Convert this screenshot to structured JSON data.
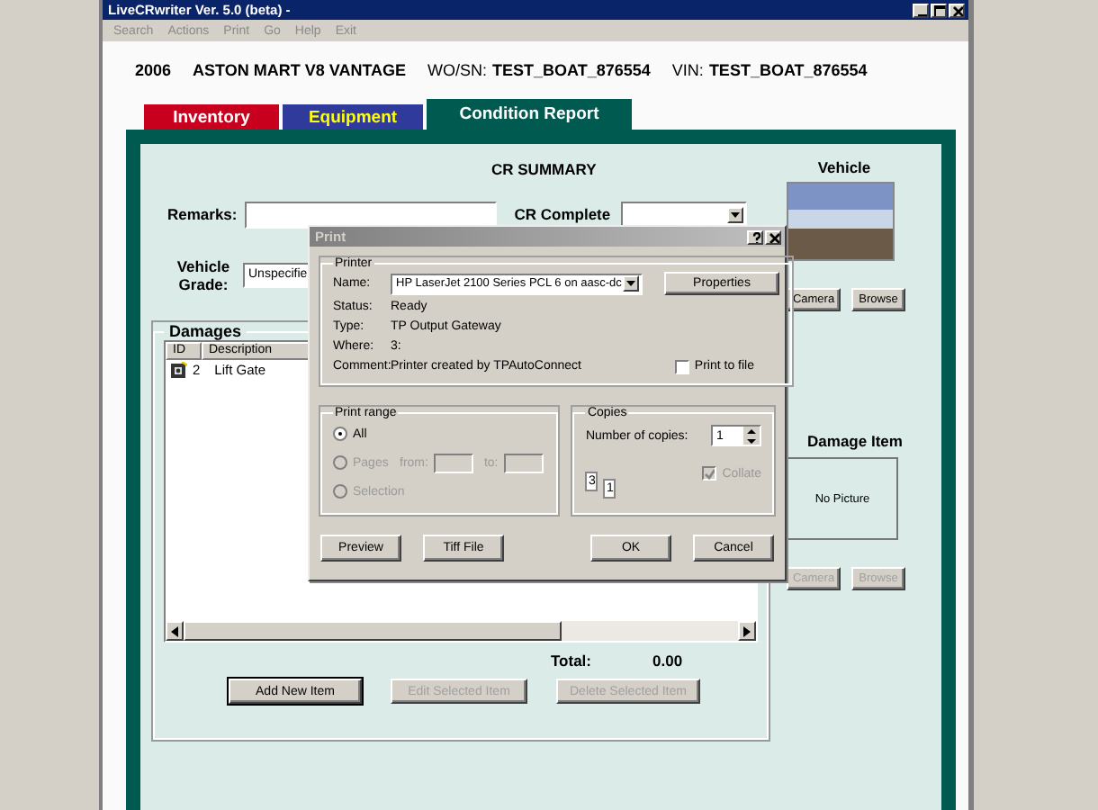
{
  "window": {
    "title": "LiveCRwriter Ver. 5.0 (beta) -"
  },
  "menu": [
    {
      "label": "Search",
      "disabled": true
    },
    {
      "label": "Actions",
      "disabled": true
    },
    {
      "label": "Print",
      "disabled": true
    },
    {
      "label": "Go",
      "disabled": true
    },
    {
      "label": "Help",
      "disabled": true
    },
    {
      "label": "Exit",
      "disabled": true
    }
  ],
  "header": {
    "year": "2006",
    "vehicle": "ASTON MART V8 VANTAGE",
    "wo_label": "WO/SN:",
    "wo_value": "TEST_BOAT_876554",
    "vin_label": "VIN:",
    "vin_value": "TEST_BOAT_876554"
  },
  "tabs": [
    {
      "label": "Inventory",
      "selected": false,
      "color": "#c8001e",
      "kind": "plain"
    },
    {
      "label": "Equipment",
      "selected": false,
      "color": "#2f3a9a",
      "kind": "accent"
    },
    {
      "label": "Condition Report",
      "selected": true,
      "color": "#005a50",
      "kind": "plain"
    }
  ],
  "summary": {
    "title": "CR SUMMARY",
    "remarks_label": "Remarks:",
    "cr_complete_label": "CR Complete",
    "grade_label": "Vehicle Grade:",
    "grade_value": "Unspecifie"
  },
  "damages": {
    "title": "Damages",
    "columns": [
      "ID",
      "Description"
    ],
    "rows": [
      {
        "id": "2",
        "description": "Lift Gate"
      }
    ],
    "total_label": "Total:",
    "total_value": "0.00",
    "buttons": [
      {
        "label": "Add New Item",
        "disabled": false
      },
      {
        "label": "Edit Selected Item",
        "disabled": true
      },
      {
        "label": "Delete Selected Item",
        "disabled": true
      }
    ]
  },
  "vehicle_panel": {
    "title": "Vehicle",
    "buttons": [
      {
        "label": "Camera",
        "disabled": false
      },
      {
        "label": "Browse",
        "disabled": false
      }
    ]
  },
  "damage_item_panel": {
    "title": "Damage Item",
    "empty_text": "No Picture",
    "buttons": [
      {
        "label": "Camera",
        "disabled": true
      },
      {
        "label": "Browse",
        "disabled": true
      }
    ]
  },
  "print_dialog": {
    "title": "Print",
    "printer_group": "Printer",
    "name_label": "Name:",
    "printer_name": "HP LaserJet 2100 Series PCL 6 on aasc-dc",
    "properties_button": "Properties",
    "details": [
      {
        "label": "Status:",
        "value": "Ready"
      },
      {
        "label": "Type:",
        "value": "TP Output Gateway"
      },
      {
        "label": "Where:",
        "value": "3:"
      },
      {
        "label": "Comment:",
        "value": "Printer created by TPAutoConnect"
      }
    ],
    "print_to_file": {
      "label": "Print to file",
      "checked": false
    },
    "range_group": "Print range",
    "range_options": [
      {
        "label": "All",
        "selected": true,
        "disabled": false
      },
      {
        "label": "Pages",
        "selected": false,
        "disabled": true,
        "from_label": "from:",
        "to_label": "to:"
      },
      {
        "label": "Selection",
        "selected": false,
        "disabled": true
      }
    ],
    "copies_group": "Copies",
    "copies_label": "Number of copies:",
    "copies_value": "1",
    "collate_pages": [
      "3",
      "1"
    ],
    "collate": {
      "label": "Collate",
      "checked": true,
      "disabled": true
    },
    "buttons": [
      {
        "label": "Preview"
      },
      {
        "label": "Tiff File"
      },
      {
        "label": "OK"
      },
      {
        "label": "Cancel"
      }
    ]
  }
}
